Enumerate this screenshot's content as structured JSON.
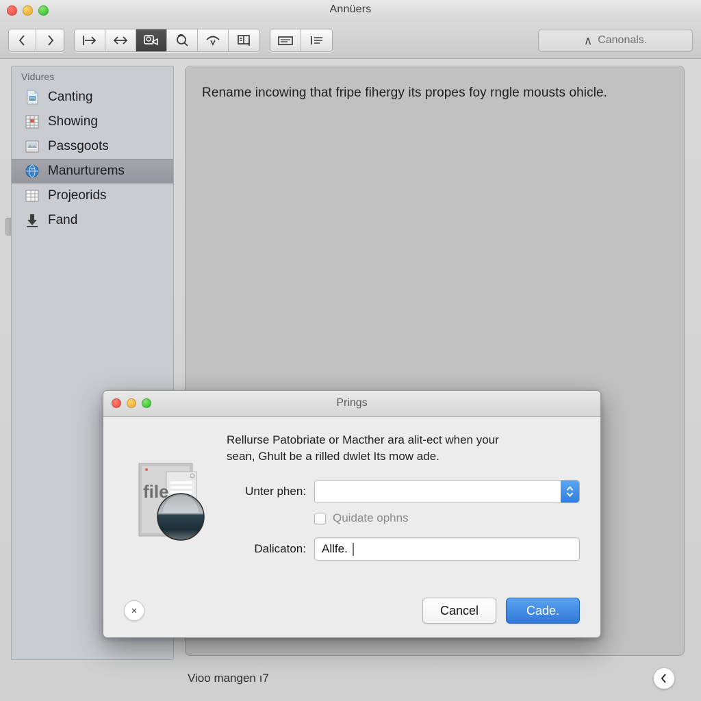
{
  "window": {
    "title": "Annüers",
    "traffic_lights": [
      "close",
      "minimize",
      "zoom"
    ]
  },
  "toolbar": {
    "nav": [
      {
        "name": "back-button",
        "icon": "chevron-left-icon",
        "glyph": "‹"
      },
      {
        "name": "forward-button",
        "icon": "chevron-right-icon",
        "glyph": "›"
      }
    ],
    "groups": [
      [
        {
          "name": "align-right-tool",
          "icon": "arrow-to-line-icon",
          "selected": false
        },
        {
          "name": "resize-tool",
          "icon": "arrows-horizontal-icon",
          "selected": false
        },
        {
          "name": "annotate-tool",
          "icon": "shape-crop-icon",
          "selected": true
        },
        {
          "name": "zoom-tool",
          "icon": "magnifier-icon",
          "selected": false
        },
        {
          "name": "signature-tool",
          "icon": "signature-icon",
          "selected": false
        },
        {
          "name": "sidebar-tool",
          "icon": "panel-split-icon",
          "selected": false
        }
      ],
      [
        {
          "name": "markup-tool",
          "icon": "text-box-icon",
          "selected": false
        },
        {
          "name": "list-tool",
          "icon": "list-lines-icon",
          "selected": false
        }
      ]
    ],
    "search": {
      "caret_glyph": "∧",
      "text": "Canonals."
    }
  },
  "sidebar": {
    "header": "Vidures",
    "items": [
      {
        "label": "Canting",
        "icon": "document-icon",
        "selected": false
      },
      {
        "label": "Showing",
        "icon": "spreadsheet-icon",
        "selected": false
      },
      {
        "label": "Passgoots",
        "icon": "photo-icon",
        "selected": false
      },
      {
        "label": "Manurturems",
        "icon": "globe-icon",
        "selected": true
      },
      {
        "label": "Projeorids",
        "icon": "table-icon",
        "selected": false
      },
      {
        "label": "Fand",
        "icon": "download-icon",
        "selected": false
      }
    ]
  },
  "main": {
    "content_line": "Rename incowing that fripe fihergy its propes foy rngle mousts ohicle."
  },
  "statusbar": {
    "text": "Vioo mangen ı7",
    "back_button_glyph": "‹"
  },
  "dialog": {
    "title": "Prings",
    "icon_name": "file-document-orb-icon",
    "icon_label": "file",
    "message_line1": "Rellurse Patobriate or Macther ara alit-ect when your",
    "message_line2": "sean, Ghult be a rilled dwlet Its mow ade.",
    "combo_row": {
      "label": "Unter phen:",
      "value": "",
      "placeholder": "",
      "stepper_icon": "stepper-up-down-icon"
    },
    "checkbox_row": {
      "label": "Quidate ophns",
      "checked": false
    },
    "text_row": {
      "label": "Dalicaton:",
      "value": "Allfe."
    },
    "help_button_glyph": "×",
    "buttons": {
      "cancel": "Cancel",
      "confirm": "Cade."
    }
  },
  "colors": {
    "accent_blue": "#2f78d8",
    "selected_row": "#9a9ea3",
    "content_panel": "#c1c1c1",
    "sidebar": "#c9ccd0"
  }
}
